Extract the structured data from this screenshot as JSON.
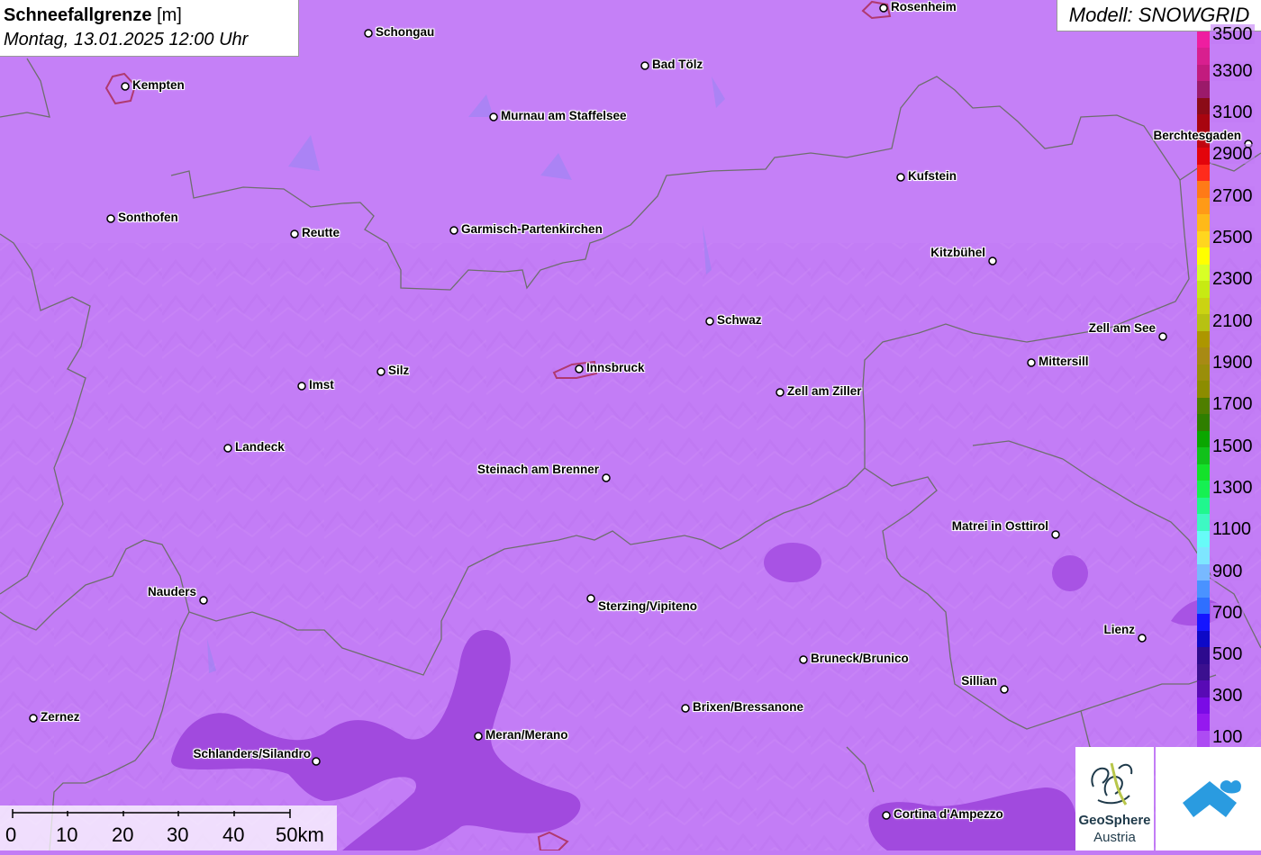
{
  "title": {
    "main": "Schneefallgrenze",
    "unit": "[m]",
    "datetime": "Montag, 13.01.2025 12:00 Uhr"
  },
  "model_label": "Modell: SNOWGRID",
  "legend": {
    "labels": [
      "3500",
      "3300",
      "3100",
      "2900",
      "2700",
      "2500",
      "2300",
      "2100",
      "1900",
      "1700",
      "1500",
      "1300",
      "1100",
      "900",
      "700",
      "500",
      "300",
      "100"
    ],
    "colors": [
      "#ee1ea0",
      "#d81f8f",
      "#c21b7e",
      "#9b1a6a",
      "#8b0b17",
      "#a8050f",
      "#c0060e",
      "#e3040b",
      "#ff2b1c",
      "#ff7a17",
      "#ff9a17",
      "#ffb919",
      "#ffd61f",
      "#ffff00",
      "#d8ff26",
      "#c7ea13",
      "#cbd312",
      "#b7c112",
      "#ad9600",
      "#a88a14",
      "#9a8e0a",
      "#8c8c00",
      "#4f7e00",
      "#2f7e00",
      "#0aa600",
      "#11c11a",
      "#14e12a",
      "#16f052",
      "#20f78e",
      "#3ef8c3",
      "#67fbf8",
      "#7ee6ff",
      "#78b9ff",
      "#4a92ff",
      "#2f6fff",
      "#1515ff",
      "#0d09c7",
      "#2d0a8e",
      "#3b108f",
      "#580ab5",
      "#7a0be6",
      "#9519ef",
      "#ad4bf3"
    ]
  },
  "cities": [
    {
      "name": "Rosenheim"
    },
    {
      "name": "Schongau"
    },
    {
      "name": "Bad Tölz"
    },
    {
      "name": "Kempten"
    },
    {
      "name": "Murnau am Staffelsee"
    },
    {
      "name": "Berchtesgaden"
    },
    {
      "name": "Kufstein"
    },
    {
      "name": "Sonthofen"
    },
    {
      "name": "Reutte"
    },
    {
      "name": "Garmisch-Partenkirchen"
    },
    {
      "name": "Kitzbühel"
    },
    {
      "name": "Schwaz"
    },
    {
      "name": "Zell am See"
    },
    {
      "name": "Mittersill"
    },
    {
      "name": "Imst"
    },
    {
      "name": "Silz"
    },
    {
      "name": "Innsbruck"
    },
    {
      "name": "Zell am Ziller"
    },
    {
      "name": "Landeck"
    },
    {
      "name": "Steinach am Brenner"
    },
    {
      "name": "Matrei in Osttirol"
    },
    {
      "name": "Nauders"
    },
    {
      "name": "Sterzing/Vipiteno"
    },
    {
      "name": "Lienz"
    },
    {
      "name": "Bruneck/Brunico"
    },
    {
      "name": "Sillian"
    },
    {
      "name": "Zernez"
    },
    {
      "name": "Brixen/Bressanone"
    },
    {
      "name": "Meran/Merano"
    },
    {
      "name": "Schlanders/Silandro"
    },
    {
      "name": "Cortina d'Ampezzo"
    }
  ],
  "scale": {
    "labels": [
      "0",
      "10",
      "20",
      "30",
      "40",
      "50km"
    ]
  },
  "logo": {
    "line1": "GeoSphere",
    "line2": "Austria"
  }
}
